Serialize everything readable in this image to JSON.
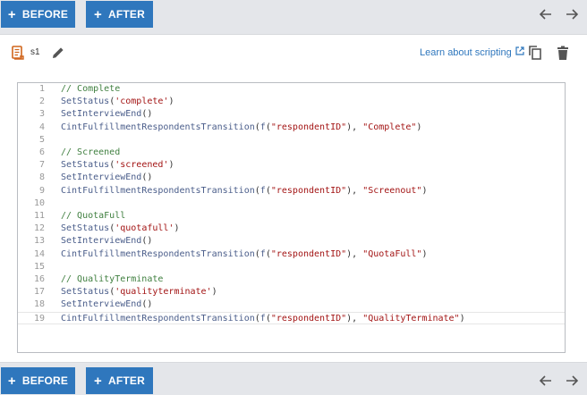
{
  "toolbar": {
    "before_label": "BEFORE",
    "after_label": "AFTER",
    "plus_glyph": "+",
    "prev_icon": "arrow-left-icon",
    "next_icon": "arrow-right-icon"
  },
  "header": {
    "script_name": "s1",
    "learn_link": "Learn about scripting"
  },
  "colors": {
    "accent": "#2f77bd",
    "comment": "#3f7f3f",
    "string": "#a31515",
    "function": "#4a5d8a",
    "icon_orange": "#d0651c"
  },
  "code": {
    "lines": [
      {
        "n": "1",
        "tokens": [
          [
            "comment",
            "// Complete"
          ]
        ]
      },
      {
        "n": "2",
        "tokens": [
          [
            "fn",
            "SetStatus"
          ],
          [
            "punc",
            "("
          ],
          [
            "str",
            "'complete'"
          ],
          [
            "punc",
            ")"
          ]
        ]
      },
      {
        "n": "3",
        "tokens": [
          [
            "fn",
            "SetInterviewEnd"
          ],
          [
            "punc",
            "()"
          ]
        ]
      },
      {
        "n": "4",
        "tokens": [
          [
            "fn",
            "CintFulfillmentRespondentsTransition"
          ],
          [
            "punc",
            "("
          ],
          [
            "fn",
            "f"
          ],
          [
            "punc",
            "("
          ],
          [
            "str",
            "\"respondentID\""
          ],
          [
            "punc",
            "), "
          ],
          [
            "str",
            "\"Complete\""
          ],
          [
            "punc",
            ")"
          ]
        ]
      },
      {
        "n": "5",
        "tokens": []
      },
      {
        "n": "6",
        "tokens": [
          [
            "comment",
            "// Screened"
          ]
        ]
      },
      {
        "n": "7",
        "tokens": [
          [
            "fn",
            "SetStatus"
          ],
          [
            "punc",
            "("
          ],
          [
            "str",
            "'screened'"
          ],
          [
            "punc",
            ")"
          ]
        ]
      },
      {
        "n": "8",
        "tokens": [
          [
            "fn",
            "SetInterviewEnd"
          ],
          [
            "punc",
            "()"
          ]
        ]
      },
      {
        "n": "9",
        "tokens": [
          [
            "fn",
            "CintFulfillmentRespondentsTransition"
          ],
          [
            "punc",
            "("
          ],
          [
            "fn",
            "f"
          ],
          [
            "punc",
            "("
          ],
          [
            "str",
            "\"respondentID\""
          ],
          [
            "punc",
            "), "
          ],
          [
            "str",
            "\"Screenout\""
          ],
          [
            "punc",
            ")"
          ]
        ]
      },
      {
        "n": "10",
        "tokens": []
      },
      {
        "n": "11",
        "tokens": [
          [
            "comment",
            "// QuotaFull"
          ]
        ]
      },
      {
        "n": "12",
        "tokens": [
          [
            "fn",
            "SetStatus"
          ],
          [
            "punc",
            "("
          ],
          [
            "str",
            "'quotafull'"
          ],
          [
            "punc",
            ")"
          ]
        ]
      },
      {
        "n": "13",
        "tokens": [
          [
            "fn",
            "SetInterviewEnd"
          ],
          [
            "punc",
            "()"
          ]
        ]
      },
      {
        "n": "14",
        "tokens": [
          [
            "fn",
            "CintFulfillmentRespondentsTransition"
          ],
          [
            "punc",
            "("
          ],
          [
            "fn",
            "f"
          ],
          [
            "punc",
            "("
          ],
          [
            "str",
            "\"respondentID\""
          ],
          [
            "punc",
            "), "
          ],
          [
            "str",
            "\"QuotaFull\""
          ],
          [
            "punc",
            ")"
          ]
        ]
      },
      {
        "n": "15",
        "tokens": []
      },
      {
        "n": "16",
        "tokens": [
          [
            "comment",
            "// QualityTerminate"
          ]
        ]
      },
      {
        "n": "17",
        "tokens": [
          [
            "fn",
            "SetStatus"
          ],
          [
            "punc",
            "("
          ],
          [
            "str",
            "'qualityterminate'"
          ],
          [
            "punc",
            ")"
          ]
        ]
      },
      {
        "n": "18",
        "tokens": [
          [
            "fn",
            "SetInterviewEnd"
          ],
          [
            "punc",
            "()"
          ]
        ]
      },
      {
        "n": "19",
        "tokens": [
          [
            "fn",
            "CintFulfillmentRespondentsTransition"
          ],
          [
            "punc",
            "("
          ],
          [
            "fn",
            "f"
          ],
          [
            "punc",
            "("
          ],
          [
            "str",
            "\"respondentID\""
          ],
          [
            "punc",
            "), "
          ],
          [
            "str",
            "\"QualityTerminate\""
          ],
          [
            "punc",
            ")"
          ]
        ]
      }
    ],
    "active_line": "19"
  }
}
